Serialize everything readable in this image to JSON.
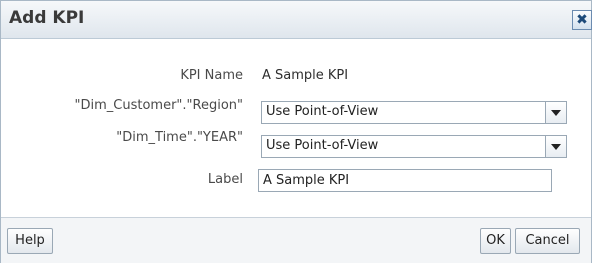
{
  "dialog": {
    "title": "Add KPI",
    "close_glyph": "✖"
  },
  "form": {
    "kpi_name_label": "KPI Name",
    "kpi_name_value": "A Sample KPI",
    "region_label": "\"Dim_Customer\".\"Region\"",
    "region_selected": "Use Point-of-View",
    "year_label": "\"Dim_Time\".\"YEAR\"",
    "year_selected": "Use Point-of-View",
    "label_label": "Label",
    "label_value": "A Sample KPI"
  },
  "buttons": {
    "help": "Help",
    "ok": "OK",
    "cancel": "Cancel"
  },
  "icons": {
    "close": "close-icon",
    "dropdown": "chevron-down-icon"
  }
}
